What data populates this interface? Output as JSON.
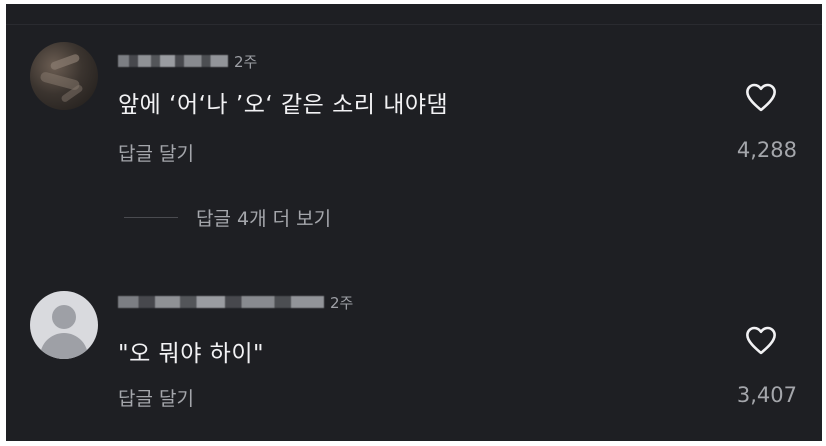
{
  "comments": [
    {
      "username": "",
      "age": "2주",
      "text": "앞에 ‘어‘나 ’오‘ 같은 소리 내야댐",
      "reply_label": "답글 달기",
      "likes": "4,288",
      "avatar_icon": "profile-photo",
      "like_icon": "heart-outline-icon"
    },
    {
      "username": "",
      "age": "2주",
      "text": "\"오 뭐야 하이\"",
      "reply_label": "답글 달기",
      "likes": "3,407",
      "avatar_icon": "default-avatar-icon",
      "like_icon": "heart-outline-icon"
    }
  ],
  "thread": {
    "more_replies_label": "답글 4개 더 보기"
  },
  "colors": {
    "background": "#1e1f23",
    "text": "#f2f2f4",
    "muted": "#a4a6ab"
  }
}
